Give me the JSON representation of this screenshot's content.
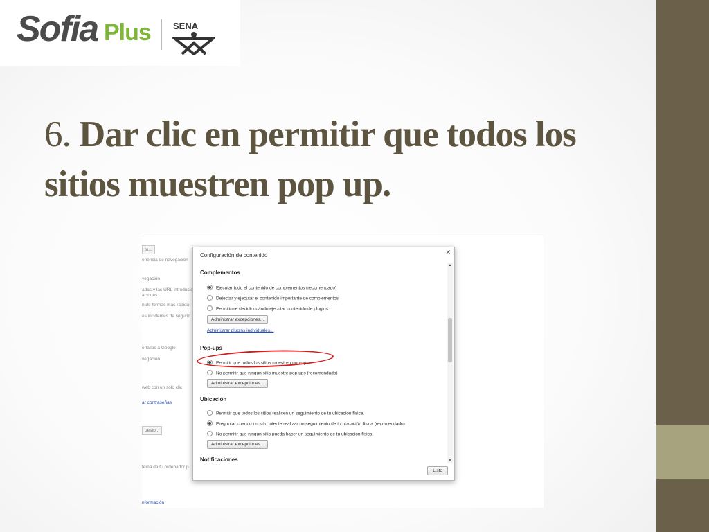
{
  "logo": {
    "sofia": "Sofia",
    "plus": "Plus",
    "sena": "SENA",
    "plus_color": "#7fb63b"
  },
  "slide": {
    "title_number": "6.",
    "title_text": "Dar clic en permitir que todos los sitios muestren pop up.",
    "title_color": "#5d5540",
    "accent_dark": "#6b6049",
    "accent_light": "#a7a37e"
  },
  "background_settings": {
    "items": [
      {
        "label": "to..."
      },
      {
        "label": "eriencia de navegación"
      },
      {
        "label": "vegación"
      },
      {
        "label": "adas y las URL introducid"
      },
      {
        "label": "aciones"
      },
      {
        "label": "n de formas más rápida"
      },
      {
        "label": "es incidentes de segurid"
      },
      {
        "label": "e fallos a Google"
      },
      {
        "label": "vegación"
      },
      {
        "label": "web con un solo clic"
      },
      {
        "label": "ar contraseñas"
      },
      {
        "label": "uesto..."
      },
      {
        "label": "tema de tu ordenador p"
      },
      {
        "label": "nformación"
      }
    ]
  },
  "dialog": {
    "title": "Configuración de contenido",
    "close_icon": "close-icon",
    "sections": {
      "complementos": {
        "heading": "Complementos",
        "options": [
          {
            "label": "Ejecutar todo el contenido de complementos (recomendado)",
            "checked": true
          },
          {
            "label": "Detectar y ejecutar el contenido importante de complementos",
            "checked": false
          },
          {
            "label": "Permitirme decidir cuándo ejecutar contenido de plugins",
            "checked": false
          }
        ],
        "button": "Administrar excepciones...",
        "link": "Administrar plugins individuales..."
      },
      "popups": {
        "heading": "Pop-ups",
        "options": [
          {
            "label": "Permitir que todos los sitios muestren pop-ups",
            "checked": true
          },
          {
            "label": "No permitir que ningún sitio muestre pop-ups (recomendado)",
            "checked": false
          }
        ],
        "button": "Administrar excepciones..."
      },
      "ubicacion": {
        "heading": "Ubicación",
        "options": [
          {
            "label": "Permitir que todos los sitios realicen un seguimiento de tu ubicación física",
            "checked": false
          },
          {
            "label": "Preguntar cuando un sitio intente realizar un seguimiento de tu ubicación física (recomendado)",
            "checked": true
          },
          {
            "label": "No permitir que ningún sitio pueda hacer un seguimiento de tu ubicación física",
            "checked": false
          }
        ],
        "button": "Administrar excepciones..."
      },
      "notificaciones": {
        "heading": "Notificaciones"
      }
    },
    "done_button": "Listo",
    "highlight_color": "#d81a1a"
  }
}
